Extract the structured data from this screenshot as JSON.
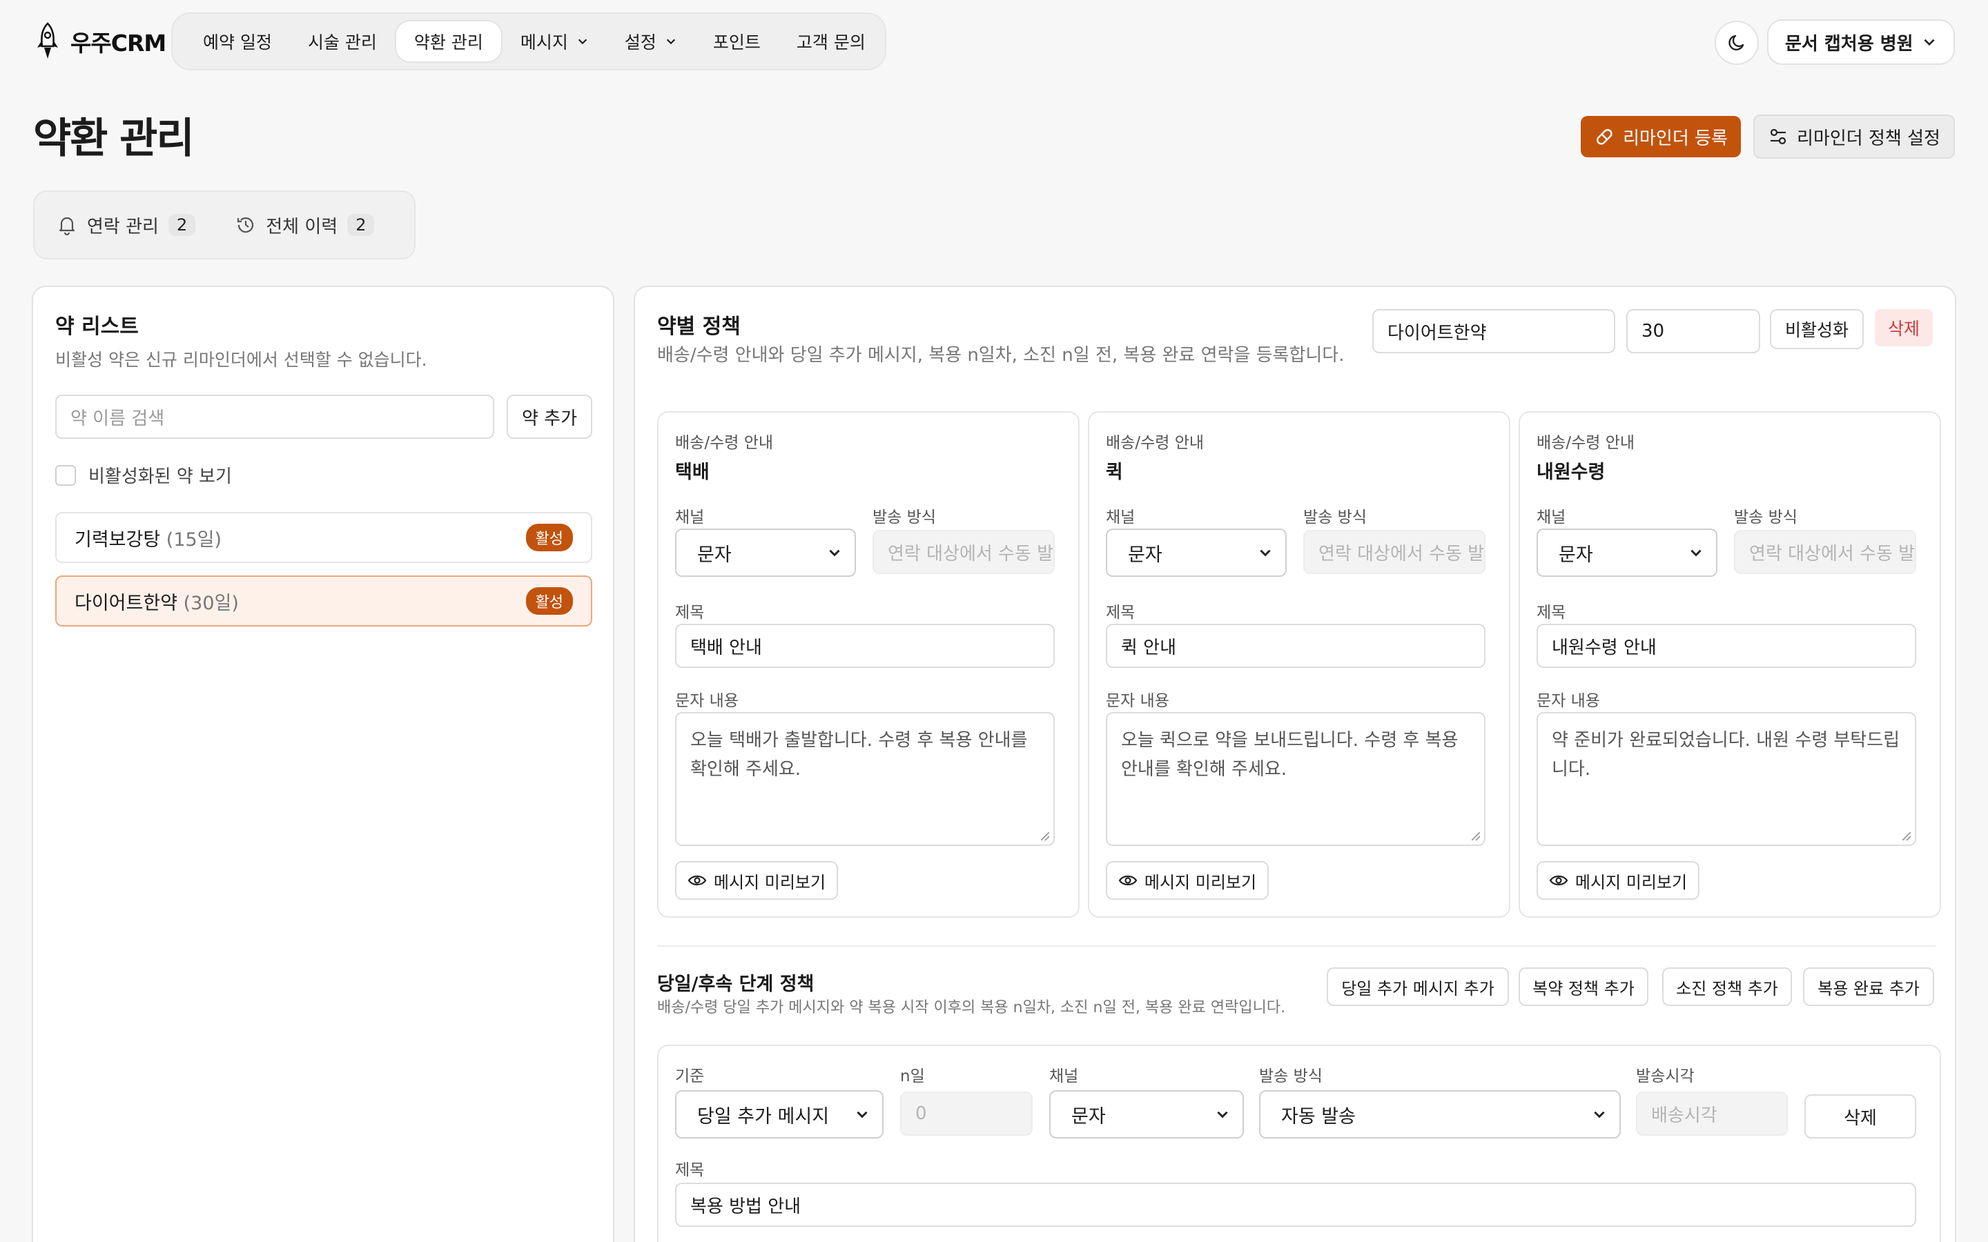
{
  "app": {
    "logo_text": "우주CRM"
  },
  "nav": {
    "items": [
      {
        "label": "예약 일정"
      },
      {
        "label": "시술 관리"
      },
      {
        "label": "약환 관리"
      },
      {
        "label": "메시지"
      },
      {
        "label": "설정"
      },
      {
        "label": "포인트"
      },
      {
        "label": "고객 문의"
      }
    ],
    "active_index": 2,
    "clinic_name": "문서 캡처용 병원"
  },
  "header": {
    "title": "약환 관리",
    "primary_button": "리마인더 등록",
    "secondary_button": "리마인더 정책 설정"
  },
  "tabs": [
    {
      "label": "연락 관리",
      "count": "2"
    },
    {
      "label": "전체 이력",
      "count": "2"
    }
  ],
  "med_list": {
    "title": "약 리스트",
    "subtitle": "비활성 약은 신규 리마인더에서 선택할 수 없습니다.",
    "search_placeholder": "약 이름 검색",
    "add_button": "약 추가",
    "show_inactive_label": "비활성화된 약 보기",
    "items": [
      {
        "name": "기력보강탕",
        "days": "(15일)",
        "status": "활성",
        "selected": false
      },
      {
        "name": "다이어트한약",
        "days": "(30일)",
        "status": "활성",
        "selected": true
      }
    ]
  },
  "policy": {
    "title": "약별 정책",
    "subtitle": "배송/수령 안내와 당일 추가 메시지, 복용 n일차, 소진 n일 전, 복용 완료 연락을 등록합니다.",
    "med_name": "다이어트한약",
    "days": "30",
    "deactivate_button": "비활성화",
    "delete_button": "삭제",
    "cards": [
      {
        "category": "배송/수령 안내",
        "type": "택배",
        "channel_label": "채널",
        "channel": "문자",
        "method_label": "발송 방식",
        "method_placeholder": "연락 대상에서 수동 발송",
        "subject_label": "제목",
        "subject": "택배 안내",
        "body_label": "문자 내용",
        "body": "오늘 택배가 출발합니다. 수령 후 복용 안내를 확인해 주세요.",
        "preview_button": "메시지 미리보기"
      },
      {
        "category": "배송/수령 안내",
        "type": "퀵",
        "channel_label": "채널",
        "channel": "문자",
        "method_label": "발송 방식",
        "method_placeholder": "연락 대상에서 수동 발송",
        "subject_label": "제목",
        "subject": "퀵 안내",
        "body_label": "문자 내용",
        "body": "오늘 퀵으로 약을 보내드립니다. 수령 후 복용 안내를 확인해 주세요.",
        "preview_button": "메시지 미리보기"
      },
      {
        "category": "배송/수령 안내",
        "type": "내원수령",
        "channel_label": "채널",
        "channel": "문자",
        "method_label": "발송 방식",
        "method_placeholder": "연락 대상에서 수동 발송",
        "subject_label": "제목",
        "subject": "내원수령 안내",
        "body_label": "문자 내용",
        "body": "약 준비가 완료되었습니다. 내원 수령 부탁드립니다.",
        "preview_button": "메시지 미리보기"
      }
    ]
  },
  "stage": {
    "title": "당일/후속 단계 정책",
    "subtitle": "배송/수령 당일 추가 메시지와 약 복용 시작 이후의 복용 n일차, 소진 n일 전, 복용 완료 연락입니다.",
    "buttons": [
      "당일 추가 메시지 추가",
      "복약 정책 추가",
      "소진 정책 추가",
      "복용 완료 추가"
    ],
    "row": {
      "basis_label": "기준",
      "basis": "당일 추가 메시지",
      "nday_label": "n일",
      "nday_placeholder": "0",
      "channel_label": "채널",
      "channel": "문자",
      "method_label": "발송 방식",
      "method": "자동 발송",
      "time_label": "발송시각",
      "time_placeholder": "배송시각",
      "delete_button": "삭제",
      "subject_label": "제목",
      "subject": "복용 방법 안내"
    }
  }
}
